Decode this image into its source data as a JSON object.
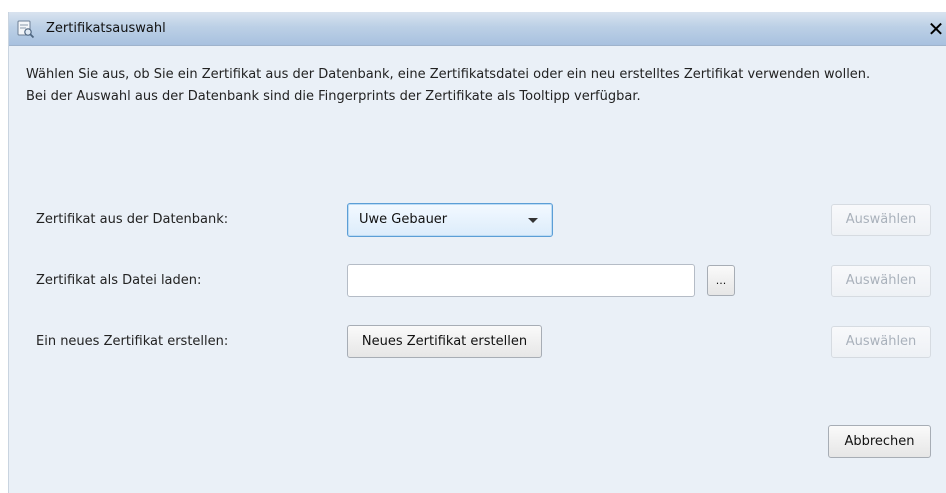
{
  "window": {
    "title": "Zertifikatsauswahl",
    "icon": "certificate-search-icon",
    "close_glyph": "✕"
  },
  "description": {
    "line1": "Wählen Sie aus, ob Sie ein Zertifikat aus der Datenbank, eine Zertifikatsdatei oder ein neu erstelltes Zertifikat verwenden wollen.",
    "line2": "Bei der Auswahl aus der Datenbank sind die Fingerprints der Zertifikate als Tooltipp verfügbar."
  },
  "rows": {
    "database": {
      "label": "Zertifikat aus der Datenbank:",
      "selected_value": "Uwe Gebauer",
      "select_button": "Auswählen"
    },
    "file": {
      "label": "Zertifikat als Datei laden:",
      "value": "",
      "browse_button": "...",
      "select_button": "Auswählen"
    },
    "new": {
      "label": "Ein neues Zertifikat erstellen:",
      "create_button": "Neues Zertifikat erstellen",
      "select_button": "Auswählen"
    }
  },
  "footer": {
    "cancel_button": "Abbrechen"
  },
  "colors": {
    "dialog_background": "#eaf0f7",
    "titlebar_start": "#d9e3ef",
    "titlebar_end": "#a8c1df",
    "combo_focus_border": "#5c9ed6",
    "disabled_text": "#a9b1bb"
  }
}
